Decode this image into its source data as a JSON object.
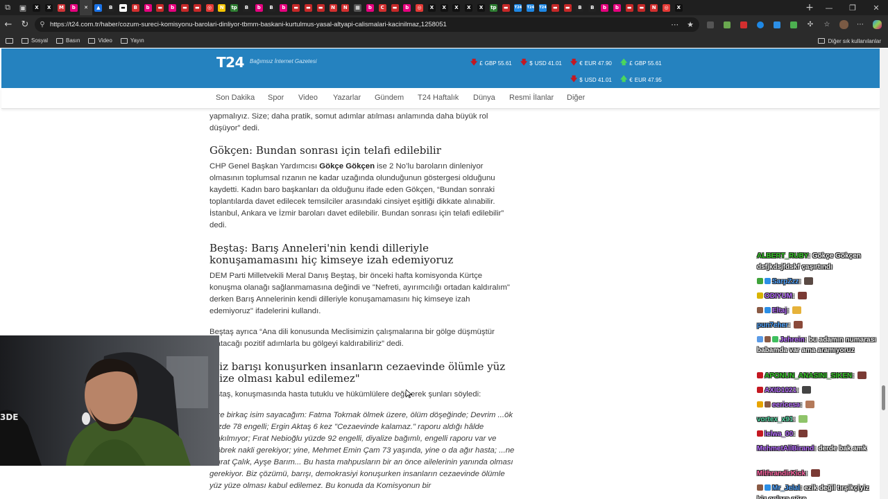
{
  "browser": {
    "url": "https://t24.com.tr/haber/cozum-sureci-komisyonu-barolari-dinliyor-tbmm-baskani-kurtulmus-yasal-altyapi-calismalari-kacinilmaz,1258051",
    "tabs": [
      {
        "letter": "X",
        "color": "#111111"
      },
      {
        "letter": "X",
        "color": "#111111"
      },
      {
        "letter": "M",
        "color": "#d13438"
      },
      {
        "letter": "b",
        "color": "#e6007e"
      },
      {
        "letter": "✕",
        "color": "#3b3b3b"
      },
      {
        "letter": "▲",
        "color": "#1a73e8"
      },
      {
        "letter": "B",
        "color": "#222222"
      },
      {
        "letter": "▬",
        "color": "#ffffff"
      },
      {
        "letter": "B",
        "color": "#d32f2f"
      },
      {
        "letter": "b",
        "color": "#e6007e"
      },
      {
        "letter": "▬",
        "color": "#c62828"
      },
      {
        "letter": "b",
        "color": "#e6007e"
      },
      {
        "letter": "▬",
        "color": "#c62828"
      },
      {
        "letter": "▬",
        "color": "#c62828"
      },
      {
        "letter": "◎",
        "color": "#e53935"
      },
      {
        "letter": "N",
        "color": "#f5c400"
      },
      {
        "letter": "tp",
        "color": "#2e7d32"
      },
      {
        "letter": "B",
        "color": "#222222"
      },
      {
        "letter": "b",
        "color": "#e6007e"
      },
      {
        "letter": "B",
        "color": "#222222"
      },
      {
        "letter": "b",
        "color": "#e6007e"
      },
      {
        "letter": "▬",
        "color": "#c62828"
      },
      {
        "letter": "▬",
        "color": "#c62828"
      },
      {
        "letter": "▬",
        "color": "#c62828"
      },
      {
        "letter": "N",
        "color": "#d32f2f"
      },
      {
        "letter": "N",
        "color": "#d32f2f"
      },
      {
        "letter": "▦",
        "color": "#555555"
      },
      {
        "letter": "b",
        "color": "#e6007e"
      },
      {
        "letter": "C",
        "color": "#d32f2f"
      },
      {
        "letter": "▬",
        "color": "#c62828"
      },
      {
        "letter": "b",
        "color": "#e6007e"
      },
      {
        "letter": "◎",
        "color": "#e53935"
      },
      {
        "letter": "X",
        "color": "#111111"
      },
      {
        "letter": "X",
        "color": "#111111"
      },
      {
        "letter": "X",
        "color": "#111111"
      },
      {
        "letter": "X",
        "color": "#111111"
      },
      {
        "letter": "X",
        "color": "#111111"
      },
      {
        "letter": "tp",
        "color": "#2e7d32"
      },
      {
        "letter": "▬",
        "color": "#c62828"
      },
      {
        "letter": "T24",
        "color": "#1e88e5"
      },
      {
        "letter": "T24",
        "color": "#1e88e5"
      },
      {
        "letter": "T24",
        "color": "#1e88e5"
      },
      {
        "letter": "▬",
        "color": "#c62828"
      },
      {
        "letter": "▬",
        "color": "#c62828"
      },
      {
        "letter": "B",
        "color": "#222222"
      },
      {
        "letter": "B",
        "color": "#222222"
      },
      {
        "letter": "b",
        "color": "#e6007e"
      },
      {
        "letter": "b",
        "color": "#e6007e"
      },
      {
        "letter": "▬",
        "color": "#c62828"
      },
      {
        "letter": "▬",
        "color": "#c62828"
      },
      {
        "letter": "N",
        "color": "#d32f2f"
      },
      {
        "letter": "◎",
        "color": "#e53935"
      },
      {
        "letter": "X",
        "color": "#111111"
      }
    ],
    "active_tab_index": 4,
    "bookmarks": [
      {
        "label": "Sosyal"
      },
      {
        "label": "Basın"
      },
      {
        "label": "Video"
      },
      {
        "label": "Yayın"
      }
    ],
    "bookmarks_other": "Diğer sık kullanılanlar"
  },
  "site": {
    "logo": "T24",
    "tagline": "Bağımsız İnternet Gazetesi",
    "rates": [
      {
        "symbol": "£",
        "label": "GBP 55.61",
        "dir": "down"
      },
      {
        "symbol": "$",
        "label": "USD 41.01",
        "dir": "down"
      },
      {
        "symbol": "€",
        "label": "EUR 47.90",
        "dir": "down"
      },
      {
        "symbol": "£",
        "label": "GBP 55.61",
        "dir": "up"
      },
      {
        "symbol": "$",
        "label": "USD 41.01",
        "dir": "down"
      },
      {
        "symbol": "€",
        "label": "EUR 47.95",
        "dir": "up"
      }
    ],
    "nav": [
      "Son Dakika",
      "Spor",
      "Video",
      "Yazarlar",
      "Gündem",
      "T24 Haftalık",
      "Dünya",
      "Resmi İlanlar",
      "Diğer"
    ]
  },
  "article": {
    "p0": "yapmalıyız. Size; daha pratik, somut adımlar atılması anlamında daha büyük rol düşüyor” dedi.",
    "h1": "Gökçen: Bundan sonrası için telafi edilebilir",
    "p1_pre": "CHP Genel Başkan Yardımcısı ",
    "p1_bold": "Gökçe Gökçen",
    "p1_post": " ise 2 No’lu baroların dinleniyor olmasının toplumsal rızanın ne kadar uzağında olunduğunun göstergesi olduğunu kaydetti. Kadın baro başkanları da olduğunu ifade eden Gökçen, “Bundan sonraki toplantılarda davet edilecek temsilciler arasındaki cinsiyet eşitliği dikkate alınabilir. İstanbul, Ankara ve İzmir baroları davet edilebilir. Bundan sonrası için telafi edilebilir” dedi.",
    "h2": "Beştaş: Barış Anneleri'nin kendi dilleriyle konuşamamasını hiç kimseye izah edemiyoruz",
    "p2": "DEM Parti Milletvekili Meral Danış Beştaş, bir önceki hafta komisyonda Kürtçe konuşma olanağı sağlanmamasına değindi ve \"Nefreti, ayırımcılığı ortadan kaldıralım\" derken Barış Annelerinin kendi dilleriyle konuşamamasını hiç kimseye izah edemiyoruz\" ifadelerini kullandı.",
    "p3": "Beştaş ayrıca “Ana dili konusunda Meclisimizin çalışmalarına bir gölge düşmüştür ...atacağı pozitif adımlarla bu gölgeyi kaldırabiliriz” dedi.",
    "h3": "...iz barışı konuşurken insanların cezaevinde ölümle yüz ...ize olması kabul edilemez\"",
    "p4": "...ştaş, konuşmasında hasta tutuklu ve hükümlülere değinerek şunları söyledi:",
    "p5": "...ze birkaç isim sayacağım: Fatma Tokmak ölmek üzere, ölüm döşeğinde; Devrim ...ök yüzde 78 engelli; Ergin Aktaş 6 kez \"Cezaevinde kalamaz.\" raporu aldığı hâlde ...akılmıyor; Fırat Nebioğlu yüzde 92 engelli, diyalize bağımlı, engelli raporu var ve ...öbrek nakli gerekiyor; yine, Mehmet Emin Çam 73 yaşında, yine o da ağır hasta; ...ne Murat Çalık, Ayşe Barım... Bu hasta mahpusların bir an önce ailelerinin yanında olması gerekiyor. Biz çözümü, barışı, demokrasiyi konuşurken insanların cezaevinde ölümle yüz yüze olması kabul edilemez. Bu konuda da Komisyonun bir"
  },
  "stream": {
    "chat": [
      {
        "user": "ALBERT_RUBY",
        "color": "#35c927",
        "text": "Gökçe Gökçen dsfjkdsjfdskf çaşırtındı",
        "badges": [],
        "emote": ""
      },
      {
        "user": "SarpZzz",
        "color": "#4fa3ff",
        "text": "",
        "badges": [
          "#3fa33a",
          "#2c8fe6"
        ],
        "emote": "#5a4a44"
      },
      {
        "user": "ODIYUM",
        "color": "#b66bff",
        "text": "",
        "badges": [
          "#d9b400"
        ],
        "emote": "#7a3a34"
      },
      {
        "user": "Eltaj",
        "color": "#b66bff",
        "text": "",
        "badges": [
          "#8a5a44",
          "#2c8fe6"
        ],
        "emote": "#e6b23a"
      },
      {
        "user": "pun7eher",
        "color": "#4fa3ff",
        "text": "",
        "badges": [],
        "emote": "#8b4a3a"
      },
      {
        "user": "Jehrein",
        "color": "#b66bff",
        "text": "bu adamın numarası babamda var ama aramıyoruz",
        "badges": [
          "#5a9ae6",
          "#8a5a44",
          "#3fbf5f"
        ],
        "emote": ""
      },
      {
        "user": "APONUN_ANASINI_SIKEN",
        "color": "#35c927",
        "text": "",
        "badges": [
          "#c41821"
        ],
        "emote": "#7a3a34"
      },
      {
        "user": "AXID1021",
        "color": "#b66bff",
        "text": "",
        "badges": [
          "#c41821"
        ],
        "emote": "#444444"
      },
      {
        "user": "eericesa",
        "color": "#b66bff",
        "text": "",
        "badges": [
          "#e8a400",
          "#8a5a44"
        ],
        "emote": "#b47a5a"
      },
      {
        "user": "vortex_x91",
        "color": "#4fd6a0",
        "text": "",
        "badges": [],
        "emote": "#8fc46a"
      },
      {
        "user": "lelwa_00",
        "color": "#b66bff",
        "text": "",
        "badges": [
          "#c41821"
        ],
        "emote": "#7a3a34"
      },
      {
        "user": "MehmetAliBirand",
        "color": "#b66bff",
        "text": "derde bak amk",
        "badges": [],
        "emote": ""
      },
      {
        "user": "MithrandirKick",
        "color": "#ff5fa0",
        "text": "",
        "badges": [],
        "emote": "#7a3a34"
      },
      {
        "user": "Mr_Jelal",
        "color": "#4fa3ff",
        "text": "ezik değil tırşikçiyiz biz onlara göre",
        "badges": [
          "#8a5a44",
          "#2c8fe6"
        ],
        "emote": ""
      }
    ]
  }
}
